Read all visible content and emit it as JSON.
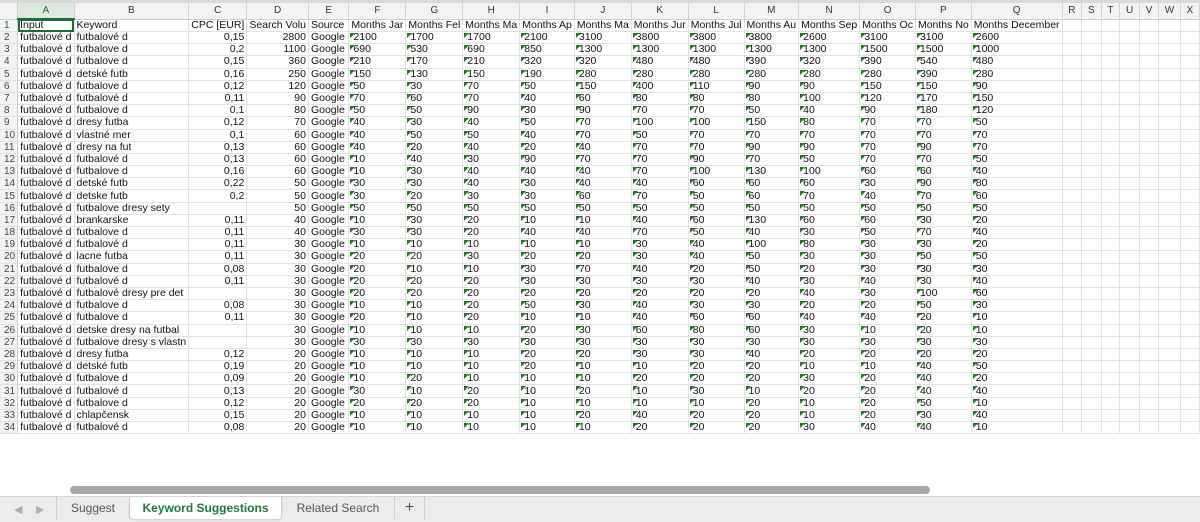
{
  "sheet": {
    "column_letters": [
      "A",
      "B",
      "C",
      "D",
      "E",
      "F",
      "G",
      "H",
      "I",
      "J",
      "K",
      "L",
      "M",
      "N",
      "O",
      "P",
      "Q",
      "R",
      "S",
      "T",
      "U",
      "V",
      "W",
      "X"
    ],
    "active_cell": "A1",
    "header_row": {
      "row_number": "1",
      "cells": [
        "Input",
        "Keyword",
        "CPC [EUR]",
        "Search Volu",
        "Source",
        "Months Jar",
        "Months Fel",
        "Months Ma",
        "Months Ap",
        "Months Ma",
        "Months Jur",
        "Months Jul",
        "Months Au",
        "Months Sep",
        "Months Oc",
        "Months No",
        "Months December"
      ]
    },
    "rows": [
      {
        "n": "2",
        "input": "futbalové d",
        "keyword": "futbalové d",
        "cpc": "0,15",
        "volume": "2800",
        "source": "Google",
        "months": [
          "2100",
          "1700",
          "1700",
          "2100",
          "3100",
          "3800",
          "3800",
          "3800",
          "2600",
          "3100",
          "3100",
          "2600"
        ]
      },
      {
        "n": "3",
        "input": "futbalové d",
        "keyword": "futbalove d",
        "cpc": "0,2",
        "volume": "1100",
        "source": "Google",
        "months": [
          "690",
          "530",
          "690",
          "850",
          "1300",
          "1300",
          "1300",
          "1300",
          "1300",
          "1500",
          "1500",
          "1000"
        ]
      },
      {
        "n": "4",
        "input": "futbalové d",
        "keyword": "futbalove d",
        "cpc": "0,15",
        "volume": "360",
        "source": "Google",
        "months": [
          "210",
          "170",
          "210",
          "320",
          "320",
          "480",
          "480",
          "390",
          "320",
          "390",
          "540",
          "480"
        ]
      },
      {
        "n": "5",
        "input": "futbalové d",
        "keyword": "detské futb",
        "cpc": "0,16",
        "volume": "250",
        "source": "Google",
        "months": [
          "150",
          "130",
          "150",
          "190",
          "280",
          "280",
          "280",
          "280",
          "280",
          "280",
          "390",
          "280"
        ]
      },
      {
        "n": "6",
        "input": "futbalové d",
        "keyword": "futbalove d",
        "cpc": "0,12",
        "volume": "120",
        "source": "Google",
        "months": [
          "50",
          "30",
          "70",
          "50",
          "150",
          "400",
          "110",
          "90",
          "90",
          "150",
          "150",
          "90"
        ]
      },
      {
        "n": "7",
        "input": "futbalové d",
        "keyword": "futbalové d",
        "cpc": "0,11",
        "volume": "90",
        "source": "Google",
        "months": [
          "70",
          "60",
          "70",
          "40",
          "60",
          "80",
          "80",
          "80",
          "100",
          "120",
          "170",
          "150"
        ]
      },
      {
        "n": "8",
        "input": "futbalové d",
        "keyword": "futbalove d",
        "cpc": "0,1",
        "volume": "80",
        "source": "Google",
        "months": [
          "50",
          "50",
          "90",
          "30",
          "90",
          "70",
          "70",
          "50",
          "40",
          "90",
          "180",
          "120"
        ]
      },
      {
        "n": "9",
        "input": "futbalové d",
        "keyword": "dresy futba",
        "cpc": "0,12",
        "volume": "70",
        "source": "Google",
        "months": [
          "40",
          "30",
          "40",
          "50",
          "70",
          "100",
          "100",
          "150",
          "80",
          "70",
          "70",
          "50"
        ]
      },
      {
        "n": "10",
        "input": "futbalové d",
        "keyword": "vlastné mer",
        "cpc": "0,1",
        "volume": "60",
        "source": "Google",
        "months": [
          "40",
          "50",
          "50",
          "40",
          "70",
          "50",
          "70",
          "70",
          "70",
          "70",
          "70",
          "70"
        ]
      },
      {
        "n": "11",
        "input": "futbalové d",
        "keyword": "dresy na fut",
        "cpc": "0,13",
        "volume": "60",
        "source": "Google",
        "months": [
          "40",
          "20",
          "40",
          "20",
          "40",
          "70",
          "70",
          "90",
          "90",
          "70",
          "90",
          "70"
        ]
      },
      {
        "n": "12",
        "input": "futbalové d",
        "keyword": "futbalové d",
        "cpc": "0,13",
        "volume": "60",
        "source": "Google",
        "months": [
          "10",
          "40",
          "30",
          "90",
          "70",
          "70",
          "90",
          "70",
          "50",
          "70",
          "70",
          "50"
        ]
      },
      {
        "n": "13",
        "input": "futbalové d",
        "keyword": "futbalove d",
        "cpc": "0,16",
        "volume": "60",
        "source": "Google",
        "months": [
          "10",
          "30",
          "40",
          "40",
          "40",
          "70",
          "100",
          "130",
          "100",
          "60",
          "60",
          "40"
        ]
      },
      {
        "n": "14",
        "input": "futbalové d",
        "keyword": "detské futb",
        "cpc": "0,22",
        "volume": "50",
        "source": "Google",
        "months": [
          "30",
          "30",
          "40",
          "30",
          "40",
          "40",
          "60",
          "60",
          "60",
          "30",
          "90",
          "80"
        ]
      },
      {
        "n": "15",
        "input": "futbalové d",
        "keyword": "detske futb",
        "cpc": "0,2",
        "volume": "50",
        "source": "Google",
        "months": [
          "30",
          "20",
          "30",
          "30",
          "60",
          "70",
          "50",
          "60",
          "70",
          "40",
          "70",
          "60"
        ]
      },
      {
        "n": "16",
        "input": "futbalové d",
        "keyword": "futbalove dresy sety",
        "cpc": "",
        "volume": "50",
        "source": "Google",
        "months": [
          "50",
          "50",
          "50",
          "50",
          "50",
          "50",
          "50",
          "50",
          "50",
          "50",
          "50",
          "50"
        ]
      },
      {
        "n": "17",
        "input": "futbalové d",
        "keyword": "brankarske",
        "cpc": "0,11",
        "volume": "40",
        "source": "Google",
        "months": [
          "10",
          "30",
          "20",
          "10",
          "10",
          "40",
          "60",
          "130",
          "60",
          "60",
          "30",
          "20"
        ]
      },
      {
        "n": "18",
        "input": "futbalové d",
        "keyword": "futbalove d",
        "cpc": "0,11",
        "volume": "40",
        "source": "Google",
        "months": [
          "30",
          "30",
          "20",
          "40",
          "40",
          "70",
          "50",
          "40",
          "30",
          "50",
          "70",
          "40"
        ]
      },
      {
        "n": "19",
        "input": "futbalové d",
        "keyword": "futbalové d",
        "cpc": "0,11",
        "volume": "30",
        "source": "Google",
        "months": [
          "10",
          "10",
          "10",
          "10",
          "10",
          "30",
          "40",
          "100",
          "80",
          "30",
          "30",
          "20"
        ]
      },
      {
        "n": "20",
        "input": "futbalové d",
        "keyword": "lacne futba",
        "cpc": "0,11",
        "volume": "30",
        "source": "Google",
        "months": [
          "20",
          "20",
          "30",
          "20",
          "20",
          "30",
          "40",
          "50",
          "30",
          "30",
          "50",
          "50"
        ]
      },
      {
        "n": "21",
        "input": "futbalové d",
        "keyword": "futbalove d",
        "cpc": "0,08",
        "volume": "30",
        "source": "Google",
        "months": [
          "20",
          "10",
          "10",
          "30",
          "70",
          "40",
          "20",
          "50",
          "20",
          "30",
          "30",
          "30"
        ]
      },
      {
        "n": "22",
        "input": "futbalové d",
        "keyword": "futbalové d",
        "cpc": "0,11",
        "volume": "30",
        "source": "Google",
        "months": [
          "20",
          "20",
          "20",
          "30",
          "30",
          "30",
          "30",
          "40",
          "30",
          "40",
          "30",
          "40"
        ]
      },
      {
        "n": "23",
        "input": "futbalové d",
        "keyword": "futbalové dresy pre det",
        "cpc": "",
        "volume": "30",
        "source": "Google",
        "months": [
          "20",
          "20",
          "20",
          "20",
          "20",
          "20",
          "20",
          "20",
          "40",
          "30",
          "100",
          "60"
        ]
      },
      {
        "n": "24",
        "input": "futbalové d",
        "keyword": "futbalove d",
        "cpc": "0,08",
        "volume": "30",
        "source": "Google",
        "months": [
          "10",
          "10",
          "20",
          "50",
          "30",
          "40",
          "30",
          "30",
          "20",
          "20",
          "50",
          "30"
        ]
      },
      {
        "n": "25",
        "input": "futbalové d",
        "keyword": "futbalove d",
        "cpc": "0,11",
        "volume": "30",
        "source": "Google",
        "months": [
          "20",
          "10",
          "20",
          "10",
          "10",
          "40",
          "60",
          "60",
          "40",
          "40",
          "20",
          "10"
        ]
      },
      {
        "n": "26",
        "input": "futbalové d",
        "keyword": "detske dresy na futbal",
        "cpc": "",
        "volume": "30",
        "source": "Google",
        "months": [
          "10",
          "10",
          "10",
          "20",
          "30",
          "60",
          "80",
          "60",
          "30",
          "10",
          "20",
          "10"
        ]
      },
      {
        "n": "27",
        "input": "futbalové d",
        "keyword": "futbalove dresy s vlastn",
        "cpc": "",
        "volume": "30",
        "source": "Google",
        "months": [
          "30",
          "30",
          "30",
          "30",
          "30",
          "30",
          "30",
          "30",
          "30",
          "30",
          "30",
          "30"
        ]
      },
      {
        "n": "28",
        "input": "futbalové d",
        "keyword": "dresy futba",
        "cpc": "0,12",
        "volume": "20",
        "source": "Google",
        "months": [
          "10",
          "10",
          "10",
          "20",
          "20",
          "30",
          "30",
          "40",
          "20",
          "20",
          "20",
          "20"
        ]
      },
      {
        "n": "29",
        "input": "futbalové d",
        "keyword": "detské futb",
        "cpc": "0,19",
        "volume": "20",
        "source": "Google",
        "months": [
          "10",
          "10",
          "10",
          "20",
          "10",
          "10",
          "20",
          "20",
          "10",
          "10",
          "40",
          "50"
        ]
      },
      {
        "n": "30",
        "input": "futbalové d",
        "keyword": "futbalove d",
        "cpc": "0,09",
        "volume": "20",
        "source": "Google",
        "months": [
          "10",
          "20",
          "10",
          "10",
          "10",
          "20",
          "20",
          "20",
          "30",
          "20",
          "40",
          "20"
        ]
      },
      {
        "n": "31",
        "input": "futbalové d",
        "keyword": "futbalové d",
        "cpc": "0,13",
        "volume": "20",
        "source": "Google",
        "months": [
          "30",
          "10",
          "20",
          "10",
          "20",
          "10",
          "30",
          "10",
          "20",
          "20",
          "40",
          "40"
        ]
      },
      {
        "n": "32",
        "input": "futbalové d",
        "keyword": "futbalove d",
        "cpc": "0,12",
        "volume": "20",
        "source": "Google",
        "months": [
          "20",
          "20",
          "20",
          "10",
          "10",
          "10",
          "10",
          "20",
          "10",
          "20",
          "50",
          "10"
        ]
      },
      {
        "n": "33",
        "input": "futbalové d",
        "keyword": "chlapčensk",
        "cpc": "0,15",
        "volume": "20",
        "source": "Google",
        "months": [
          "10",
          "10",
          "10",
          "10",
          "20",
          "40",
          "20",
          "20",
          "10",
          "20",
          "30",
          "40"
        ]
      },
      {
        "n": "34",
        "input": "futbalové d",
        "keyword": "futbalové d",
        "cpc": "0,08",
        "volume": "20",
        "source": "Google",
        "months": [
          "10",
          "10",
          "10",
          "10",
          "10",
          "20",
          "20",
          "20",
          "30",
          "40",
          "40",
          "10"
        ]
      }
    ]
  },
  "tabs": {
    "prev_icon": "◀",
    "next_icon": "▶",
    "items": [
      {
        "label": "Suggest",
        "active": false
      },
      {
        "label": "Keyword Suggestions",
        "active": true
      },
      {
        "label": "Related Search",
        "active": false
      }
    ],
    "add_label": "+"
  },
  "colors": {
    "accent": "#1d7a3f",
    "triangle": "#1f7a1f"
  }
}
